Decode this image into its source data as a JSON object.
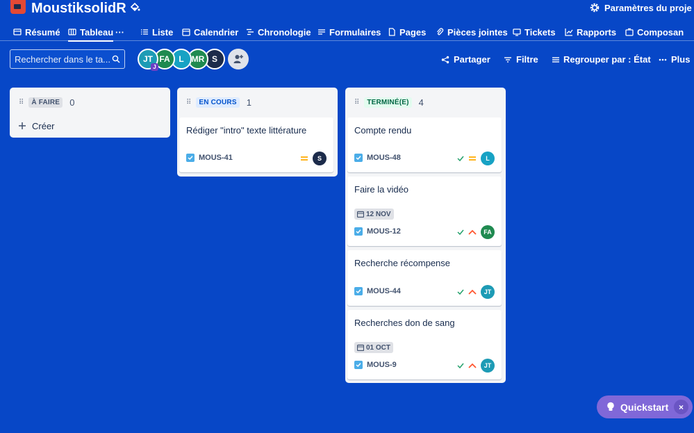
{
  "header": {
    "project_title": "MoustiksolidR",
    "settings_label": "Paramètres du proje"
  },
  "tabs": [
    {
      "label": "Résumé",
      "icon": "globe-icon"
    },
    {
      "label": "Tableau",
      "icon": "board-icon",
      "active": true
    },
    {
      "label": "Liste",
      "icon": "list-icon"
    },
    {
      "label": "Calendrier",
      "icon": "calendar-icon"
    },
    {
      "label": "Chronologie",
      "icon": "timeline-icon"
    },
    {
      "label": "Formulaires",
      "icon": "form-icon"
    },
    {
      "label": "Pages",
      "icon": "page-icon"
    },
    {
      "label": "Pièces jointes",
      "icon": "attachment-icon"
    },
    {
      "label": "Tickets",
      "icon": "ticket-icon"
    },
    {
      "label": "Rapports",
      "icon": "chart-icon"
    },
    {
      "label": "Composan",
      "icon": "component-icon"
    }
  ],
  "tab_more": "···",
  "toolbar": {
    "search_placeholder": "Rechercher dans le ta...",
    "share_label": "Partager",
    "filter_label": "Filtre",
    "group_label": "Regrouper par : État",
    "more_label": "Plus"
  },
  "avatars": [
    {
      "initials": "JT",
      "color": "#1d9bb5",
      "sub": "J"
    },
    {
      "initials": "FA",
      "color": "#1f8a50"
    },
    {
      "initials": "L",
      "color": "#17a2c4"
    },
    {
      "initials": "MR",
      "color": "#1f8a50"
    },
    {
      "initials": "S",
      "color": "#1c2b4a"
    }
  ],
  "columns": [
    {
      "status": "À FAIRE",
      "count": "0",
      "status_bg": "#dfe1e6",
      "status_color": "#42526e",
      "create_label": "Créer",
      "cards": []
    },
    {
      "status": "EN COURS",
      "count": "1",
      "status_bg": "#deebff",
      "status_color": "#0052cc",
      "cards": [
        {
          "title": "Rédiger \"intro\" texte littérature",
          "key": "MOUS-41",
          "priority": "medium",
          "done": false,
          "assignee": "S",
          "assignee_color": "#1c2b4a"
        }
      ]
    },
    {
      "status": "TERMINÉ(E)",
      "count": "4",
      "status_bg": "#e3fcef",
      "status_color": "#006644",
      "cards": [
        {
          "title": "Compte rendu",
          "key": "MOUS-48",
          "priority": "medium",
          "done": true,
          "assignee": "L",
          "assignee_color": "#17a2c4"
        },
        {
          "title": "Faire la vidéo",
          "date": "12 NOV",
          "key": "MOUS-12",
          "priority": "high",
          "done": true,
          "assignee": "FA",
          "assignee_color": "#1f8a50"
        },
        {
          "title": "Recherche récompense",
          "key": "MOUS-44",
          "priority": "high",
          "done": true,
          "assignee": "JT",
          "assignee_color": "#1d9bb5"
        },
        {
          "title": "Recherches don de sang",
          "date": "01 OCT",
          "key": "MOUS-9",
          "priority": "high",
          "done": true,
          "assignee": "JT",
          "assignee_color": "#1d9bb5"
        }
      ]
    }
  ],
  "quickstart": {
    "label": "Quickstart",
    "close": "×"
  }
}
